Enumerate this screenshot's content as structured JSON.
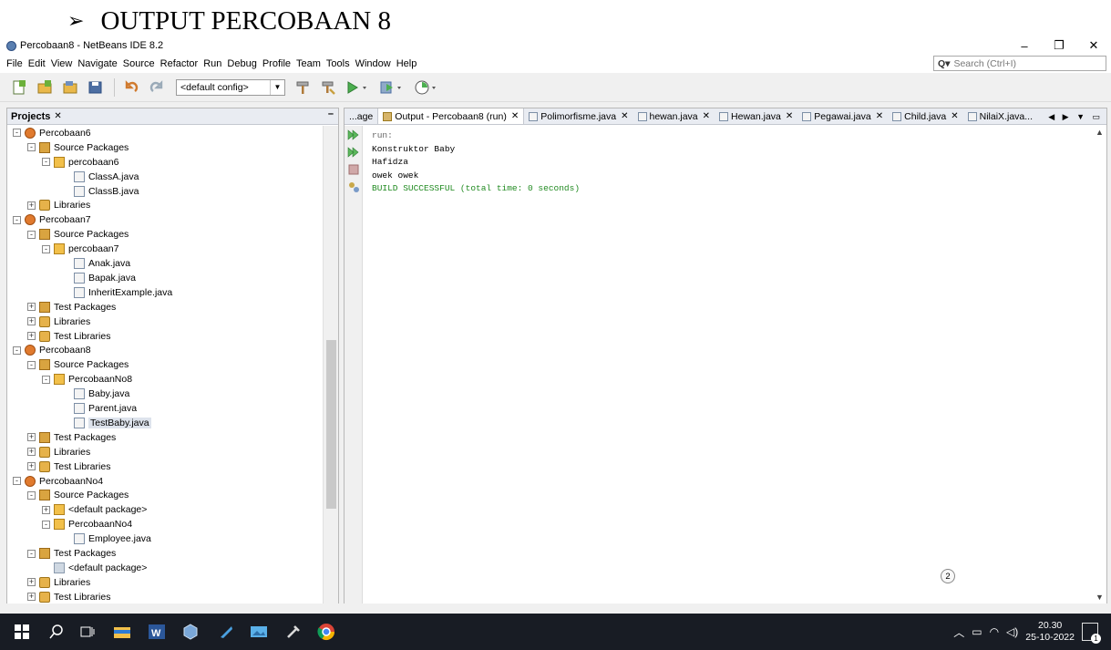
{
  "document": {
    "heading": "OUTPUT PERCOBAAN 8",
    "bullet": "➢"
  },
  "window": {
    "title": "Percobaan8 - NetBeans IDE 8.2",
    "controls": {
      "minimize": "–",
      "maximize": "❐",
      "close": "✕"
    }
  },
  "menu": {
    "items": [
      "File",
      "Edit",
      "View",
      "Navigate",
      "Source",
      "Refactor",
      "Run",
      "Debug",
      "Profile",
      "Team",
      "Tools",
      "Window",
      "Help"
    ],
    "search_placeholder": "Search (Ctrl+I)"
  },
  "toolbar": {
    "config_select": "<default config>"
  },
  "projects": {
    "tab_label": "Projects",
    "close": "✕",
    "minimize": "–",
    "tree": [
      {
        "label": "Percobaan6",
        "type": "project",
        "level": 0,
        "expander": "-"
      },
      {
        "label": "Source Packages",
        "type": "srcpkg",
        "level": 1,
        "expander": "-"
      },
      {
        "label": "percobaan6",
        "type": "pkg",
        "level": 2,
        "expander": "-"
      },
      {
        "label": "ClassA.java",
        "type": "java",
        "level": 3
      },
      {
        "label": "ClassB.java",
        "type": "java",
        "level": 3
      },
      {
        "label": "Libraries",
        "type": "lib",
        "level": 1,
        "expander": "+"
      },
      {
        "label": "Percobaan7",
        "type": "project",
        "level": 0,
        "expander": "-"
      },
      {
        "label": "Source Packages",
        "type": "srcpkg",
        "level": 1,
        "expander": "-"
      },
      {
        "label": "percobaan7",
        "type": "pkg",
        "level": 2,
        "expander": "-"
      },
      {
        "label": "Anak.java",
        "type": "java",
        "level": 3
      },
      {
        "label": "Bapak.java",
        "type": "java",
        "level": 3
      },
      {
        "label": "InheritExample.java",
        "type": "java",
        "level": 3
      },
      {
        "label": "Test Packages",
        "type": "srcpkg",
        "level": 1,
        "expander": "+"
      },
      {
        "label": "Libraries",
        "type": "lib",
        "level": 1,
        "expander": "+"
      },
      {
        "label": "Test Libraries",
        "type": "lib",
        "level": 1,
        "expander": "+"
      },
      {
        "label": "Percobaan8",
        "type": "project",
        "level": 0,
        "expander": "-"
      },
      {
        "label": "Source Packages",
        "type": "srcpkg",
        "level": 1,
        "expander": "-"
      },
      {
        "label": "PercobaanNo8",
        "type": "pkg",
        "level": 2,
        "expander": "-"
      },
      {
        "label": "Baby.java",
        "type": "java",
        "level": 3
      },
      {
        "label": "Parent.java",
        "type": "java",
        "level": 3
      },
      {
        "label": "TestBaby.java",
        "type": "java",
        "level": 3,
        "selected": true
      },
      {
        "label": "Test Packages",
        "type": "srcpkg",
        "level": 1,
        "expander": "+"
      },
      {
        "label": "Libraries",
        "type": "lib",
        "level": 1,
        "expander": "+"
      },
      {
        "label": "Test Libraries",
        "type": "lib",
        "level": 1,
        "expander": "+"
      },
      {
        "label": "PercobaanNo4",
        "type": "project",
        "level": 0,
        "expander": "-"
      },
      {
        "label": "Source Packages",
        "type": "srcpkg",
        "level": 1,
        "expander": "-"
      },
      {
        "label": "<default package>",
        "type": "pkg",
        "level": 2,
        "expander": "+"
      },
      {
        "label": "PercobaanNo4",
        "type": "pkg",
        "level": 2,
        "expander": "-"
      },
      {
        "label": "Employee.java",
        "type": "java",
        "level": 3
      },
      {
        "label": "Test Packages",
        "type": "srcpkg",
        "level": 1,
        "expander": "-"
      },
      {
        "label": "<default package>",
        "type": "pkg-gray",
        "level": 2
      },
      {
        "label": "Libraries",
        "type": "lib",
        "level": 1,
        "expander": "+"
      },
      {
        "label": "Test Libraries",
        "type": "lib",
        "level": 1,
        "expander": "+"
      }
    ]
  },
  "editor": {
    "tabs": [
      {
        "label": "...age",
        "active": false,
        "closable": false
      },
      {
        "label": "Output - Percobaan8 (run)",
        "active": true,
        "closable": true
      },
      {
        "label": "Polimorfisme.java",
        "active": false,
        "closable": true
      },
      {
        "label": "hewan.java",
        "active": false,
        "closable": true
      },
      {
        "label": "Hewan.java",
        "active": false,
        "closable": true
      },
      {
        "label": "Pegawai.java",
        "active": false,
        "closable": true
      },
      {
        "label": "Child.java",
        "active": false,
        "closable": true
      },
      {
        "label": "NilaiX.java...",
        "active": false,
        "closable": false
      }
    ],
    "tab_close": "✕",
    "tab_nav": "◀ ▶ ▼ ▭"
  },
  "output": {
    "run_line": "run:",
    "lines": [
      "Konstruktor Baby",
      "Hafidza",
      "owek owek"
    ],
    "success_line": "BUILD SUCCESSFUL (total time: 0 seconds)"
  },
  "status": {
    "notification_count": "2"
  },
  "taskbar": {
    "time": "20.30",
    "date": "25-10-2022",
    "action_center_badge": "1",
    "tray_icons": [
      "chevron-up-icon",
      "battery-icon",
      "wifi-icon",
      "speaker-icon"
    ]
  },
  "colors": {
    "success": "#228b22",
    "panel_header": "#e9ecf2",
    "taskbar": "#181c24"
  }
}
